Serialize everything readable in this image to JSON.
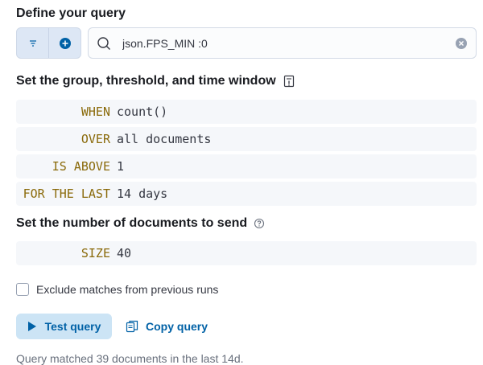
{
  "define_query": {
    "title": "Define your query",
    "search_value": "json.FPS_MIN :0",
    "icons": [
      "filter-icon",
      "plus-circle-icon",
      "search-icon",
      "clear-icon"
    ]
  },
  "group_section": {
    "title": "Set the group, threshold, and time window",
    "rows": [
      {
        "keyword": "WHEN",
        "value": "count()"
      },
      {
        "keyword": "OVER",
        "value": "all documents"
      },
      {
        "keyword": "IS ABOVE",
        "value": "1"
      },
      {
        "keyword": "FOR THE LAST",
        "value": "14 days"
      }
    ]
  },
  "docs_section": {
    "title": "Set the number of documents to send",
    "size_keyword": "SIZE",
    "size_value": "40"
  },
  "exclude_checkbox": {
    "label": "Exclude matches from previous runs",
    "checked": false
  },
  "actions": {
    "test_query": "Test query",
    "copy_query": "Copy query"
  },
  "result_text": "Query matched 39 documents in the last 14d.",
  "colors": {
    "accent": "#0061a6",
    "keyword": "#8a6a0a",
    "button_bg": "#cce4f5"
  }
}
